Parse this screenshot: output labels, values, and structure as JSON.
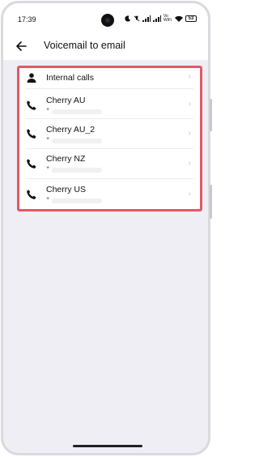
{
  "status": {
    "time": "17:39",
    "vowifi": "Vo WiFi",
    "battery": "53"
  },
  "appbar": {
    "title": "Voicemail to email"
  },
  "list": {
    "items": [
      {
        "label": "Internal calls",
        "icon": "person-icon",
        "number_prefix": ""
      },
      {
        "label": "Cherry AU",
        "icon": "phone-icon",
        "number_prefix": "+"
      },
      {
        "label": "Cherry AU_2",
        "icon": "phone-icon",
        "number_prefix": "+"
      },
      {
        "label": "Cherry NZ",
        "icon": "phone-icon",
        "number_prefix": "+"
      },
      {
        "label": "Cherry US",
        "icon": "phone-icon",
        "number_prefix": "+"
      }
    ],
    "chevron": "›"
  },
  "colors": {
    "highlight_border": "#e45865",
    "background": "#eeeef4"
  }
}
